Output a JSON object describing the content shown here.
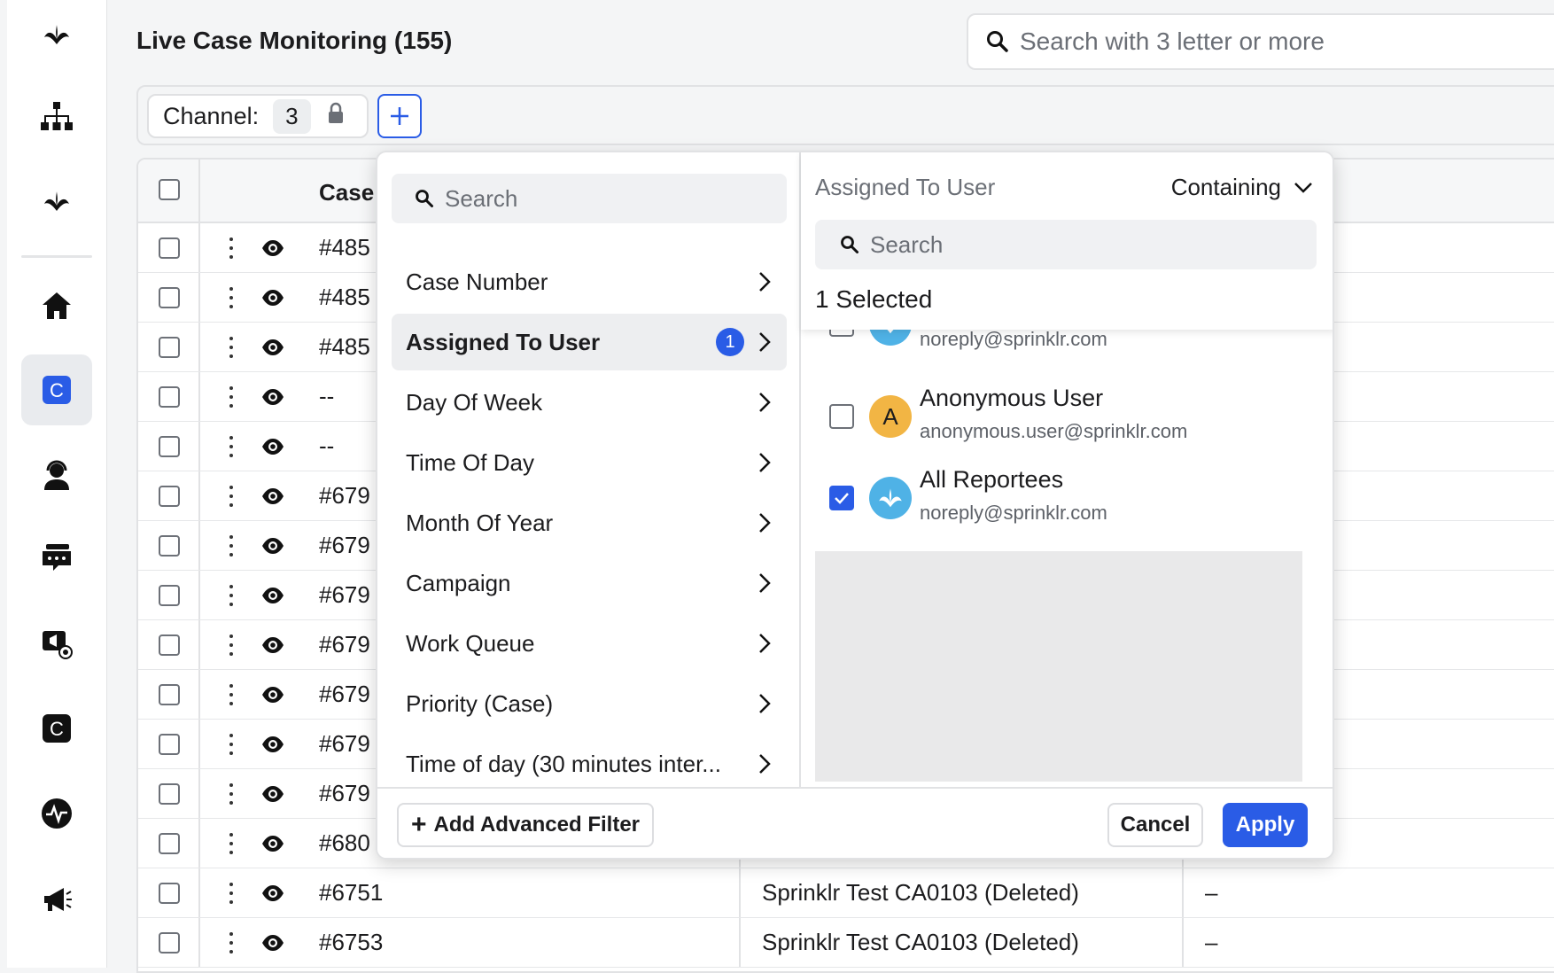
{
  "app": {
    "title": "Live Case Monitoring (155)"
  },
  "search": {
    "placeholder": "Search with 3 letter or more"
  },
  "filter_bar": {
    "channel_label": "Channel:",
    "channel_count": "3",
    "add_icon": "plus-icon"
  },
  "sidebar": {
    "items": [
      {
        "icon": "sprinklr-logo-icon"
      },
      {
        "icon": "hierarchy-icon"
      },
      {
        "icon": "sprinklr-logo-icon"
      },
      {
        "icon": "home-icon"
      },
      {
        "icon": "case-icon",
        "active": true
      },
      {
        "icon": "agent-headset-icon"
      },
      {
        "icon": "chat-icon"
      },
      {
        "icon": "monitor-megaphone-icon"
      },
      {
        "icon": "case-icon"
      },
      {
        "icon": "pulse-icon"
      },
      {
        "icon": "megaphone-icon"
      }
    ]
  },
  "table": {
    "header": {
      "case": "Case"
    },
    "rows": [
      {
        "case": "#485",
        "col2": "",
        "col3": ""
      },
      {
        "case": "#485",
        "col2": "",
        "col3": ""
      },
      {
        "case": "#485",
        "col2": "",
        "col3": ""
      },
      {
        "case": "--",
        "col2": "",
        "col3": ""
      },
      {
        "case": "--",
        "col2": "",
        "col3": ""
      },
      {
        "case": "#679",
        "col2": "",
        "col3": ""
      },
      {
        "case": "#679",
        "col2": "",
        "col3": ""
      },
      {
        "case": "#679",
        "col2": "",
        "col3": ""
      },
      {
        "case": "#679",
        "col2": "",
        "col3": ""
      },
      {
        "case": "#679",
        "col2": "",
        "col3": ""
      },
      {
        "case": "#679",
        "col2": "",
        "col3": ""
      },
      {
        "case": "#679",
        "col2": "",
        "col3": ""
      },
      {
        "case": "#680",
        "col2": "",
        "col3": ""
      },
      {
        "case": "#6751",
        "col2": "Sprinklr Test CA0103 (Deleted)",
        "col3": "–"
      },
      {
        "case": "#6753",
        "col2": "Sprinklr Test CA0103 (Deleted)",
        "col3": "–"
      }
    ]
  },
  "filter_popup": {
    "search_placeholder": "Search",
    "menu": [
      {
        "label": "Case Number"
      },
      {
        "label": "Assigned To User",
        "active": true,
        "badge": "1"
      },
      {
        "label": "Day Of Week"
      },
      {
        "label": "Time Of Day"
      },
      {
        "label": "Month Of Year"
      },
      {
        "label": "Campaign"
      },
      {
        "label": "Work Queue"
      },
      {
        "label": "Priority (Case)"
      },
      {
        "label": "Time of day (30 minutes inter..."
      }
    ],
    "right": {
      "title": "Assigned To User",
      "operator": "Containing",
      "search_placeholder": "Search",
      "selected_text": "1 Selected",
      "users": [
        {
          "name": "",
          "email": "noreply@sprinklr.com",
          "avatar": "sprinklr-logo-icon",
          "checked": false
        },
        {
          "name": "Anonymous User",
          "email": "anonymous.user@sprinklr.com",
          "avatar_letter": "A",
          "checked": false
        },
        {
          "name": "All Reportees",
          "email": "noreply@sprinklr.com",
          "avatar": "sprinklr-logo-icon",
          "checked": true
        }
      ]
    },
    "footer": {
      "add_advanced": "Add Advanced Filter",
      "cancel": "Cancel",
      "apply": "Apply"
    }
  },
  "colors": {
    "accent": "#2a5ce6",
    "sprinklr_blue": "#4fb2e6",
    "anon_avatar": "#f2b544"
  }
}
